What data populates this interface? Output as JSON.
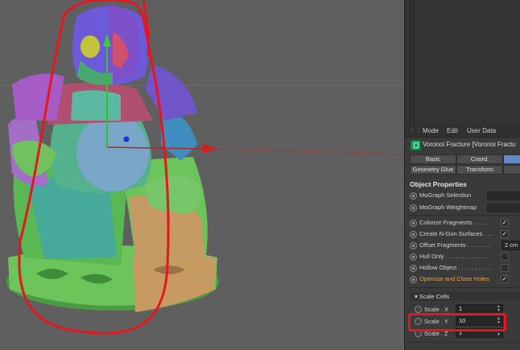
{
  "colors": {
    "viewport_bg": "#5f5f5f",
    "annotation_red": "#e8141e",
    "accent_blue": "#5f8ac7",
    "highlight_orange": "#f0a030"
  },
  "attributes": {
    "menu": [
      "Mode",
      "Edit",
      "User Data"
    ],
    "object_title": "Voronoi Fracture [Voronoi Fractu",
    "object_icon": "voronoi-fracture-icon",
    "tabs_row1": [
      "Basic",
      "Coord.",
      ""
    ],
    "tabs_row2": [
      "Geometry Glue",
      "Transform",
      ""
    ],
    "section_title": "Object Properties",
    "props": [
      {
        "label": "MoGraph Selection",
        "kind": "field",
        "value": ""
      },
      {
        "label": "MoGraph Weightmap",
        "kind": "field",
        "value": ""
      },
      {
        "label": "Colorize Fragments . . . . .",
        "kind": "check",
        "value": "✓"
      },
      {
        "label": "Create N-Gon Surfaces . . .",
        "kind": "check",
        "value": "✓"
      },
      {
        "label": "Offset Fragments . . . . . . .",
        "kind": "number",
        "value": "2 cm"
      },
      {
        "label": "Hull Only . . . . . . . . . . . . .",
        "kind": "check",
        "value": ""
      },
      {
        "label": "Hollow Object . . . . . . . . . .",
        "kind": "check",
        "value": ""
      },
      {
        "label": "Optimize and Close Holes",
        "kind": "check",
        "value": "✓",
        "highlighted": true
      }
    ],
    "scale_section": "Scale Cells",
    "scale_rows": [
      {
        "label": "Scale . X",
        "value": "1"
      },
      {
        "label": "Scale . Y",
        "value": "10"
      },
      {
        "label": "Scale . Z",
        "value": "1"
      }
    ]
  }
}
